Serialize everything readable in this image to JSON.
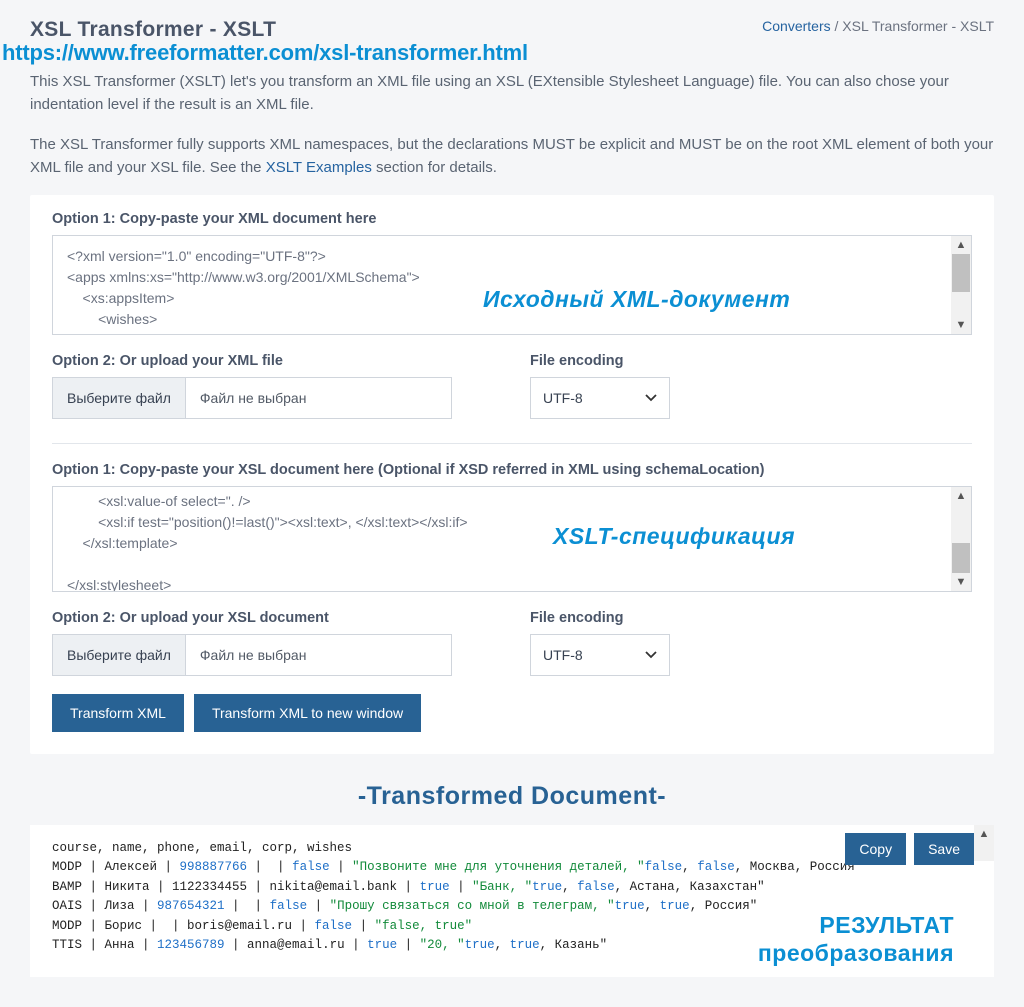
{
  "header": {
    "title": "XSL Transformer - XSLT",
    "breadcrumb_link": "Converters",
    "breadcrumb_sep": " / ",
    "breadcrumb_current": "XSL Transformer - XSLT"
  },
  "overlay_url": "https://www.freeformatter.com/xsl-transformer.html",
  "intro": {
    "p1": "This XSL Transformer (XSLT) let's you transform an XML file using an XSL (EXtensible Stylesheet Language) file. You can also chose your indentation level if the result is an XML file.",
    "p2a": "The XSL Transformer fully supports XML namespaces, but the declarations MUST be explicit and MUST be on the root XML element of both your XML file and your XSL file. See the ",
    "p2_link": "XSLT Examples",
    "p2b": " section for details."
  },
  "xml_section": {
    "opt1_label": "Option 1: Copy-paste your XML document here",
    "content": "<?xml version=\"1.0\" encoding=\"UTF-8\"?>\n<apps xmlns:xs=\"http://www.w3.org/2001/XMLSchema\">\n    <xs:appsItem>\n        <wishes>\n            <info>Позвоните мне для уточнения деталей</info>",
    "opt2_label": "Option 2: Or upload your XML file",
    "file_btn": "Выберите файл",
    "file_status": "Файл не выбран",
    "encoding_label": "File encoding",
    "encoding_value": "UTF-8",
    "annotation": "Исходный XML-документ"
  },
  "xsl_section": {
    "opt1_label": "Option 1: Copy-paste your XSL document here (Optional if XSD referred in XML using schemaLocation)",
    "content": "        <xsl:value-of select=\". />\n        <xsl:if test=\"position()!=last()\"><xsl:text>, </xsl:text></xsl:if>\n    </xsl:template>\n\n</xsl:stylesheet>",
    "opt2_label": "Option 2: Or upload your XSL document",
    "file_btn": "Выберите файл",
    "file_status": "Файл не выбран",
    "encoding_label": "File encoding",
    "encoding_value": "UTF-8",
    "annotation": "XSLT-спецификация"
  },
  "buttons": {
    "transform": "Transform XML",
    "transform_new": "Transform XML to new window"
  },
  "output": {
    "title": "-Transformed Document-",
    "copy": "Copy",
    "save": "Save",
    "header_line": "course, name, phone, email, corp, wishes",
    "rows": [
      {
        "course": "MODP",
        "name": "Алексей",
        "phone": "998887766",
        "email": "",
        "corp": "",
        "b1": "false",
        "wish": "Позвоните мне для уточнения деталей",
        "b2": "false",
        "b3": "false",
        "loc": "Москва, Россия"
      },
      {
        "course": "BAMP",
        "name": "Никита",
        "phone": "1122334455",
        "email": "nikita@email.bank",
        "b1": "true",
        "wish": "Банк",
        "b2": "true",
        "b3": "false",
        "loc": "Астана, Казахстан"
      },
      {
        "course": "OAIS",
        "name": "Лиза",
        "phone": "987654321",
        "email": "",
        "b1": "false",
        "wish": "Прошу связаться со мной в телеграм",
        "b2": "true",
        "b3": "true",
        "loc": "Россия"
      },
      {
        "course": "MODP",
        "name": "Борис",
        "phone": "",
        "email": "boris@email.ru",
        "b1": "false",
        "wish": "false, true"
      },
      {
        "course": "TTIS",
        "name": "Анна",
        "phone": "123456789",
        "email": "anna@email.ru",
        "b1": "true",
        "wish": "20",
        "b2": "true",
        "b3": "true",
        "loc": "Казань"
      }
    ],
    "annotation_l1": "РЕЗУЛЬТАТ",
    "annotation_l2": "преобразования"
  }
}
